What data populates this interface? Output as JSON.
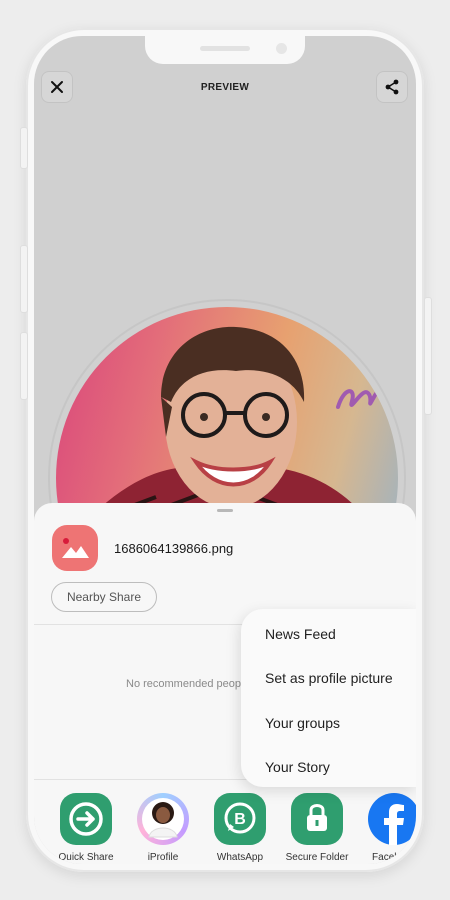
{
  "header": {
    "title": "PREVIEW",
    "close_icon": "close-icon",
    "share_icon": "share-icon"
  },
  "share_sheet": {
    "file_name": "1686064139866.png",
    "file_icon": "gallery-image-icon",
    "nearby_share_label": "Nearby Share",
    "no_recommended_text": "No recommended people"
  },
  "context_menu": {
    "items": [
      "News Feed",
      "Set as profile picture",
      "Your groups",
      "Your Story"
    ]
  },
  "apps": [
    {
      "label": "Quick Share",
      "icon": "quick-share-icon",
      "color": "#2f9e6f"
    },
    {
      "label": "iProfile",
      "icon": "iprofile-icon"
    },
    {
      "label": "WhatsApp Business",
      "icon": "whatsapp-business-icon",
      "color": "#2f9e6f"
    },
    {
      "label": "Secure Folder",
      "icon": "secure-folder-icon",
      "color": "#2f9e6f"
    },
    {
      "label": "Facebook",
      "icon": "facebook-icon",
      "color": "#1877f2"
    }
  ],
  "colors": {
    "accent_green": "#2f9e6f",
    "file_icon_bg": "#ee7474",
    "facebook_blue": "#1877f2"
  }
}
